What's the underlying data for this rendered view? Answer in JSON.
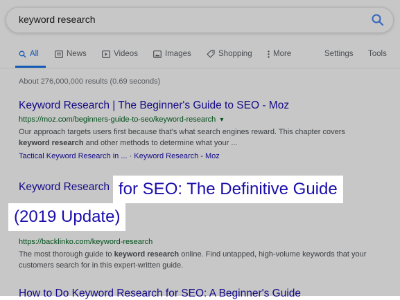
{
  "search": {
    "query": "keyword research"
  },
  "tabs": [
    {
      "label": "All",
      "icon": "search-icon",
      "active": true
    },
    {
      "label": "News",
      "icon": "news-icon"
    },
    {
      "label": "Videos",
      "icon": "video-icon"
    },
    {
      "label": "Images",
      "icon": "image-icon"
    },
    {
      "label": "Shopping",
      "icon": "tag-icon"
    },
    {
      "label": "More",
      "icon": "more-icon"
    }
  ],
  "tools": {
    "settings": "Settings",
    "tools": "Tools"
  },
  "stats": "About 276,000,000 results (0.69 seconds)",
  "results": [
    {
      "title": "Keyword Research | The Beginner's Guide to SEO - Moz",
      "url": "https://moz.com/beginners-guide-to-seo/keyword-research",
      "url_arrow": "▾",
      "snippet_line1": "Our approach targets users first because that's what search engines reward. This chapter covers",
      "snippet_bold": "keyword research",
      "snippet_line2_rest": " and other methods to determine what your ...",
      "sitelink1": "Tactical Keyword Research in ...",
      "sitelink_sep": " · ",
      "sitelink2": "Keyword Research - Moz"
    },
    {
      "title_start": "Keyword Research",
      "highlight_line1": "for SEO: The Definitive Guide",
      "highlight_line2": "(2019 Update)",
      "url": "https://backlinko.com/keyword-research",
      "snippet_pre": "The most thorough guide to ",
      "snippet_bold": "keyword research",
      "snippet_post": " online. Find untapped, high-volume keywords that your",
      "snippet_line2": "customers search for in this expert-written guide."
    },
    {
      "title": "How to Do Keyword Research for SEO: A Beginner's Guide"
    }
  ],
  "colors": {
    "link": "#1a0dab",
    "url": "#006621",
    "accent": "#1a73e8",
    "snippet": "#4d5156"
  }
}
